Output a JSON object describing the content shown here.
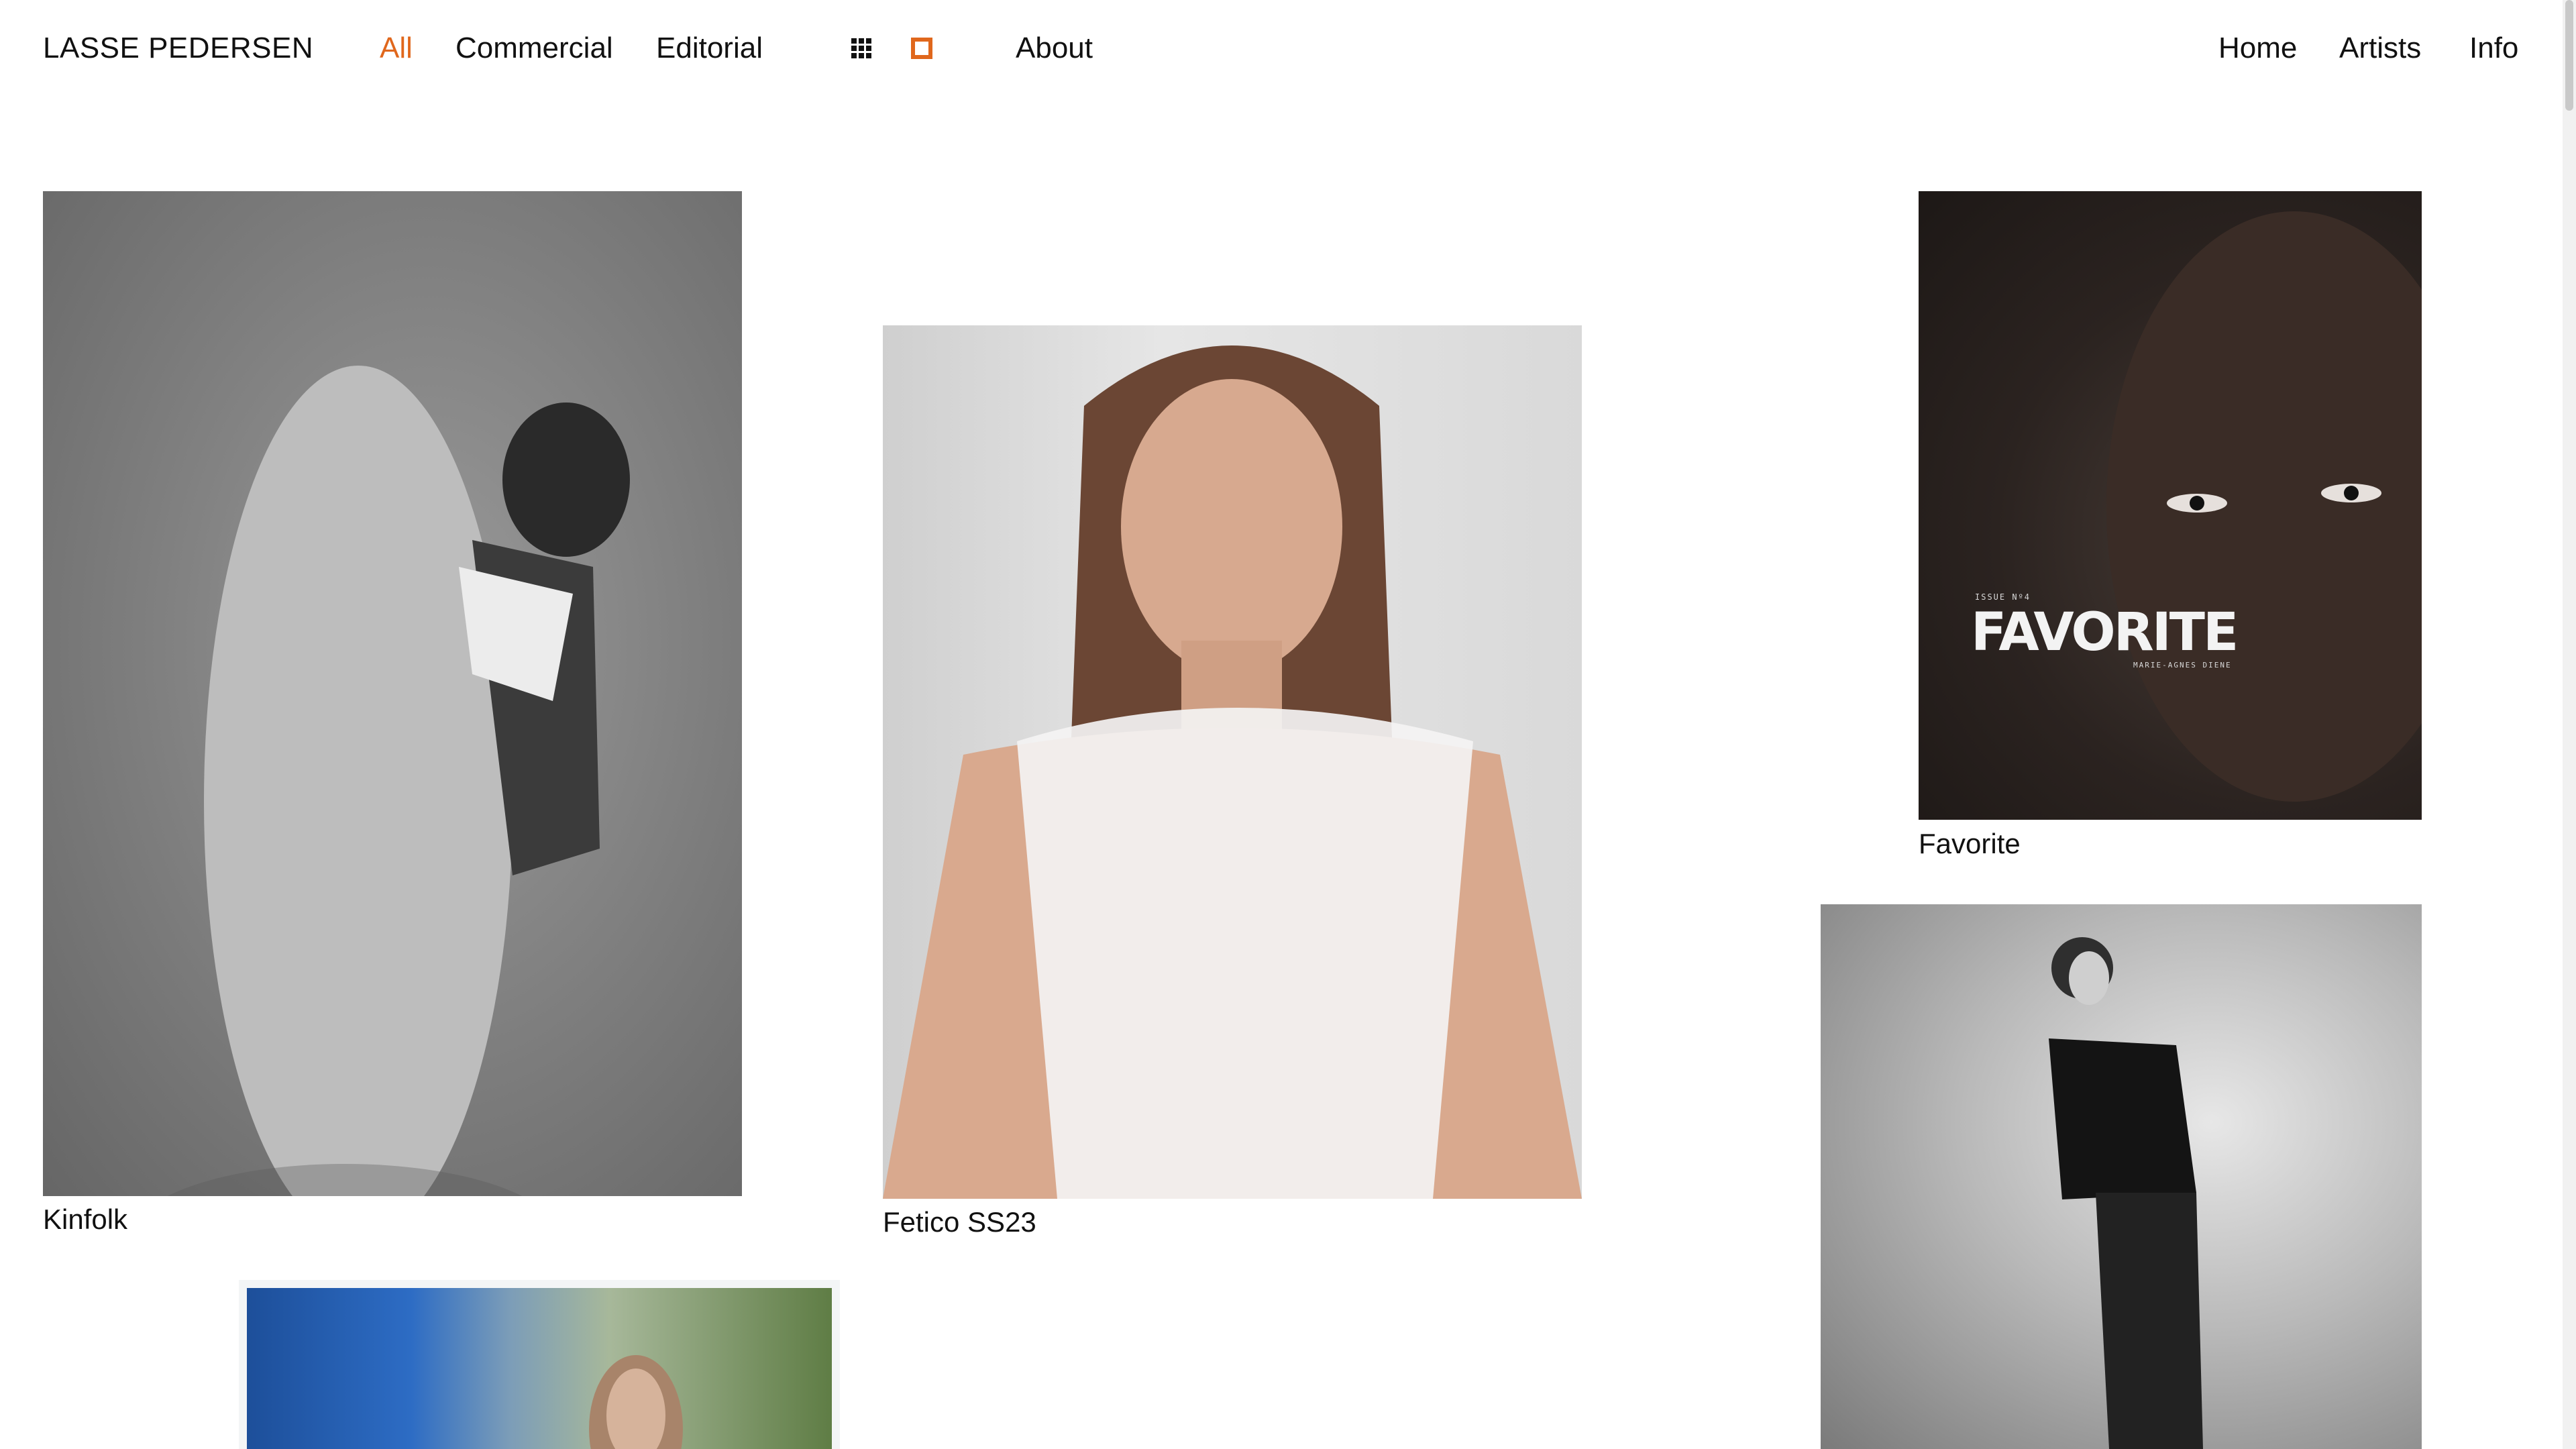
{
  "header": {
    "brand": "LASSE PEDERSEN",
    "filters": [
      {
        "label": "All",
        "active": true
      },
      {
        "label": "Commercial",
        "active": false
      },
      {
        "label": "Editorial",
        "active": false
      }
    ],
    "view_toggle": [
      {
        "icon": "grid-view-icon",
        "active": false
      },
      {
        "icon": "single-view-icon",
        "active": true
      }
    ],
    "about_label": "About",
    "right_nav": [
      {
        "label": "Home"
      },
      {
        "label": "Artists"
      },
      {
        "label": "Info"
      }
    ]
  },
  "accent_color": "#e0671c",
  "gallery": [
    {
      "caption": "Kinfolk"
    },
    {
      "caption": "Fetico SS23"
    },
    {
      "caption": "Favorite",
      "cover_title": "FAVORITE",
      "cover_issue": "ISSUE Nº4",
      "cover_subtitle": "MARIE-AGNES DIENE"
    },
    {
      "caption": ""
    },
    {
      "caption": ""
    }
  ]
}
